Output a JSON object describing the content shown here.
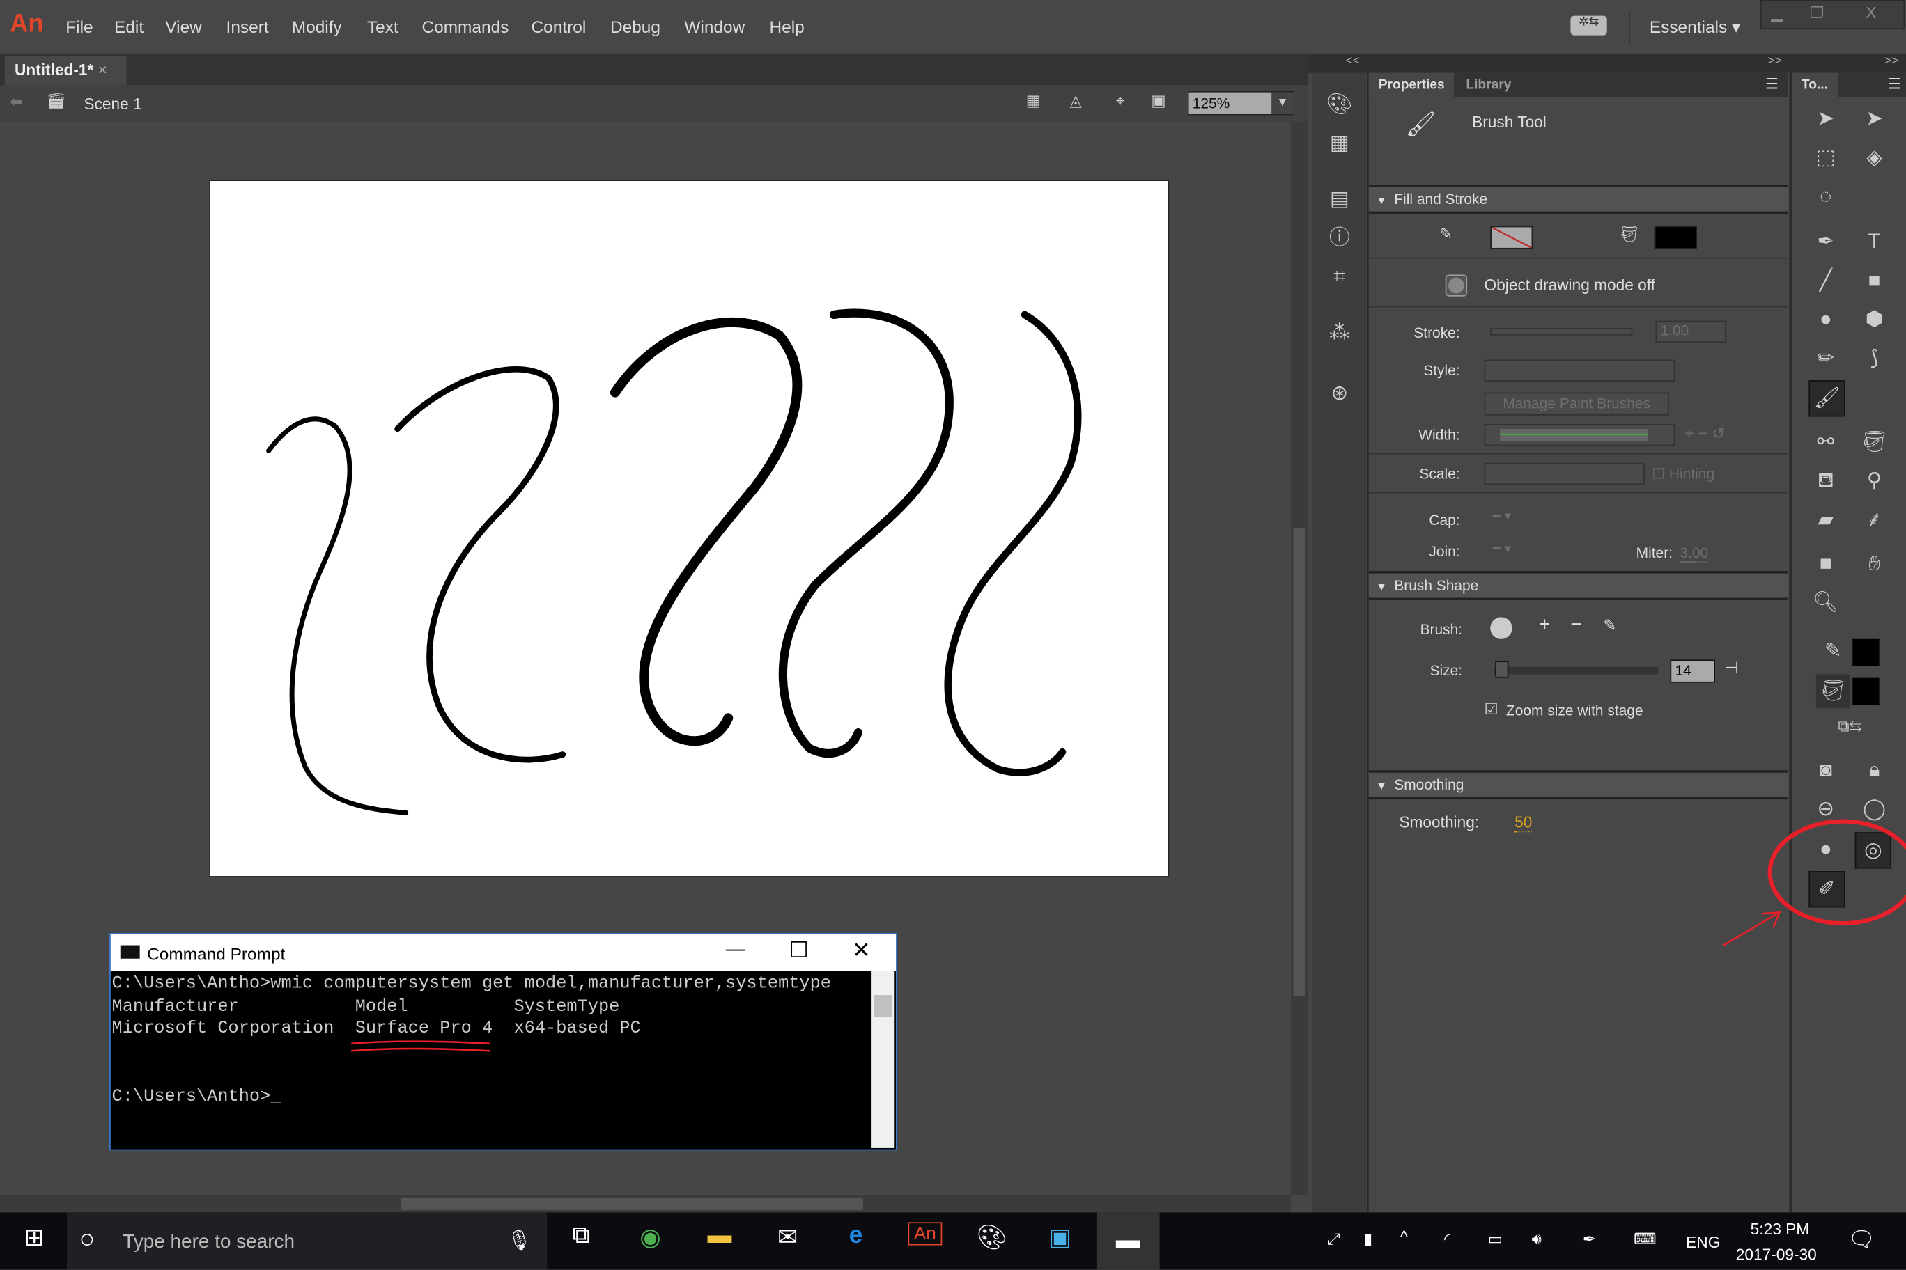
{
  "app": {
    "logo": "An",
    "menu": [
      "File",
      "Edit",
      "View",
      "Insert",
      "Modify",
      "Text",
      "Commands",
      "Control",
      "Debug",
      "Window",
      "Help"
    ],
    "workspace": "Essentials",
    "win_controls": [
      "minimize",
      "restore",
      "close"
    ]
  },
  "document": {
    "tab": "Untitled-1*",
    "scene": "Scene 1",
    "zoom": "125%"
  },
  "panels": {
    "collapse_left": "<<",
    "collapse_right": ">>"
  },
  "properties": {
    "tabs": [
      "Properties",
      "Library"
    ],
    "tool_name": "Brush Tool",
    "fill_stroke": {
      "header": "Fill and Stroke",
      "stroke_color": "none",
      "fill_color": "#000000",
      "object_drawing": "Object drawing mode off",
      "stroke_label": "Stroke:",
      "stroke_value": "1.00",
      "style_label": "Style:",
      "manage_brushes": "Manage Paint Brushes",
      "width_label": "Width:",
      "scale_label": "Scale:",
      "hinting": "Hinting",
      "cap_label": "Cap:",
      "join_label": "Join:",
      "miter_label": "Miter:",
      "miter_value": "3.00"
    },
    "brush_shape": {
      "header": "Brush Shape",
      "brush_label": "Brush:",
      "size_label": "Size:",
      "size_value": "14",
      "zoom_with_stage": "Zoom size with stage",
      "zoom_checked": true
    },
    "smoothing": {
      "header": "Smoothing",
      "label": "Smoothing:",
      "value": "50"
    }
  },
  "tools": {
    "tab": "To...",
    "items": [
      "selection-icon",
      "subselection-icon",
      "free-transform-icon",
      "3d-rotation-icon",
      "lasso-icon",
      "",
      "pen-icon",
      "text-icon",
      "line-icon",
      "rectangle-icon",
      "oval-icon",
      "polystar-icon",
      "pencil-icon",
      "paint-brush-icon",
      "brush-icon",
      "",
      "bone-icon",
      "paint-bucket-icon",
      "ink-bottle-icon",
      "eyedropper-icon",
      "eraser-icon",
      "asset-warp-icon",
      "camera-icon",
      "hand-icon",
      "zoom-icon",
      ""
    ],
    "stroke_color": "#000000",
    "fill_color": "#000000"
  },
  "command_prompt": {
    "title": "Command Prompt",
    "lines": [
      "C:\\Users\\Antho>wmic computersystem get model,manufacturer,systemtype",
      "Manufacturer           Model          SystemType",
      "Microsoft Corporation  Surface Pro 4  x64-based PC",
      "",
      "",
      "C:\\Users\\Antho>_"
    ]
  },
  "taskbar": {
    "search_placeholder": "Type here to search",
    "language": "ENG",
    "time": "5:23 PM",
    "date": "2017-09-30"
  },
  "colors": {
    "accent": "#e0462a",
    "annotation": "#e8202a",
    "smoothing_value": "#d6a21e"
  }
}
